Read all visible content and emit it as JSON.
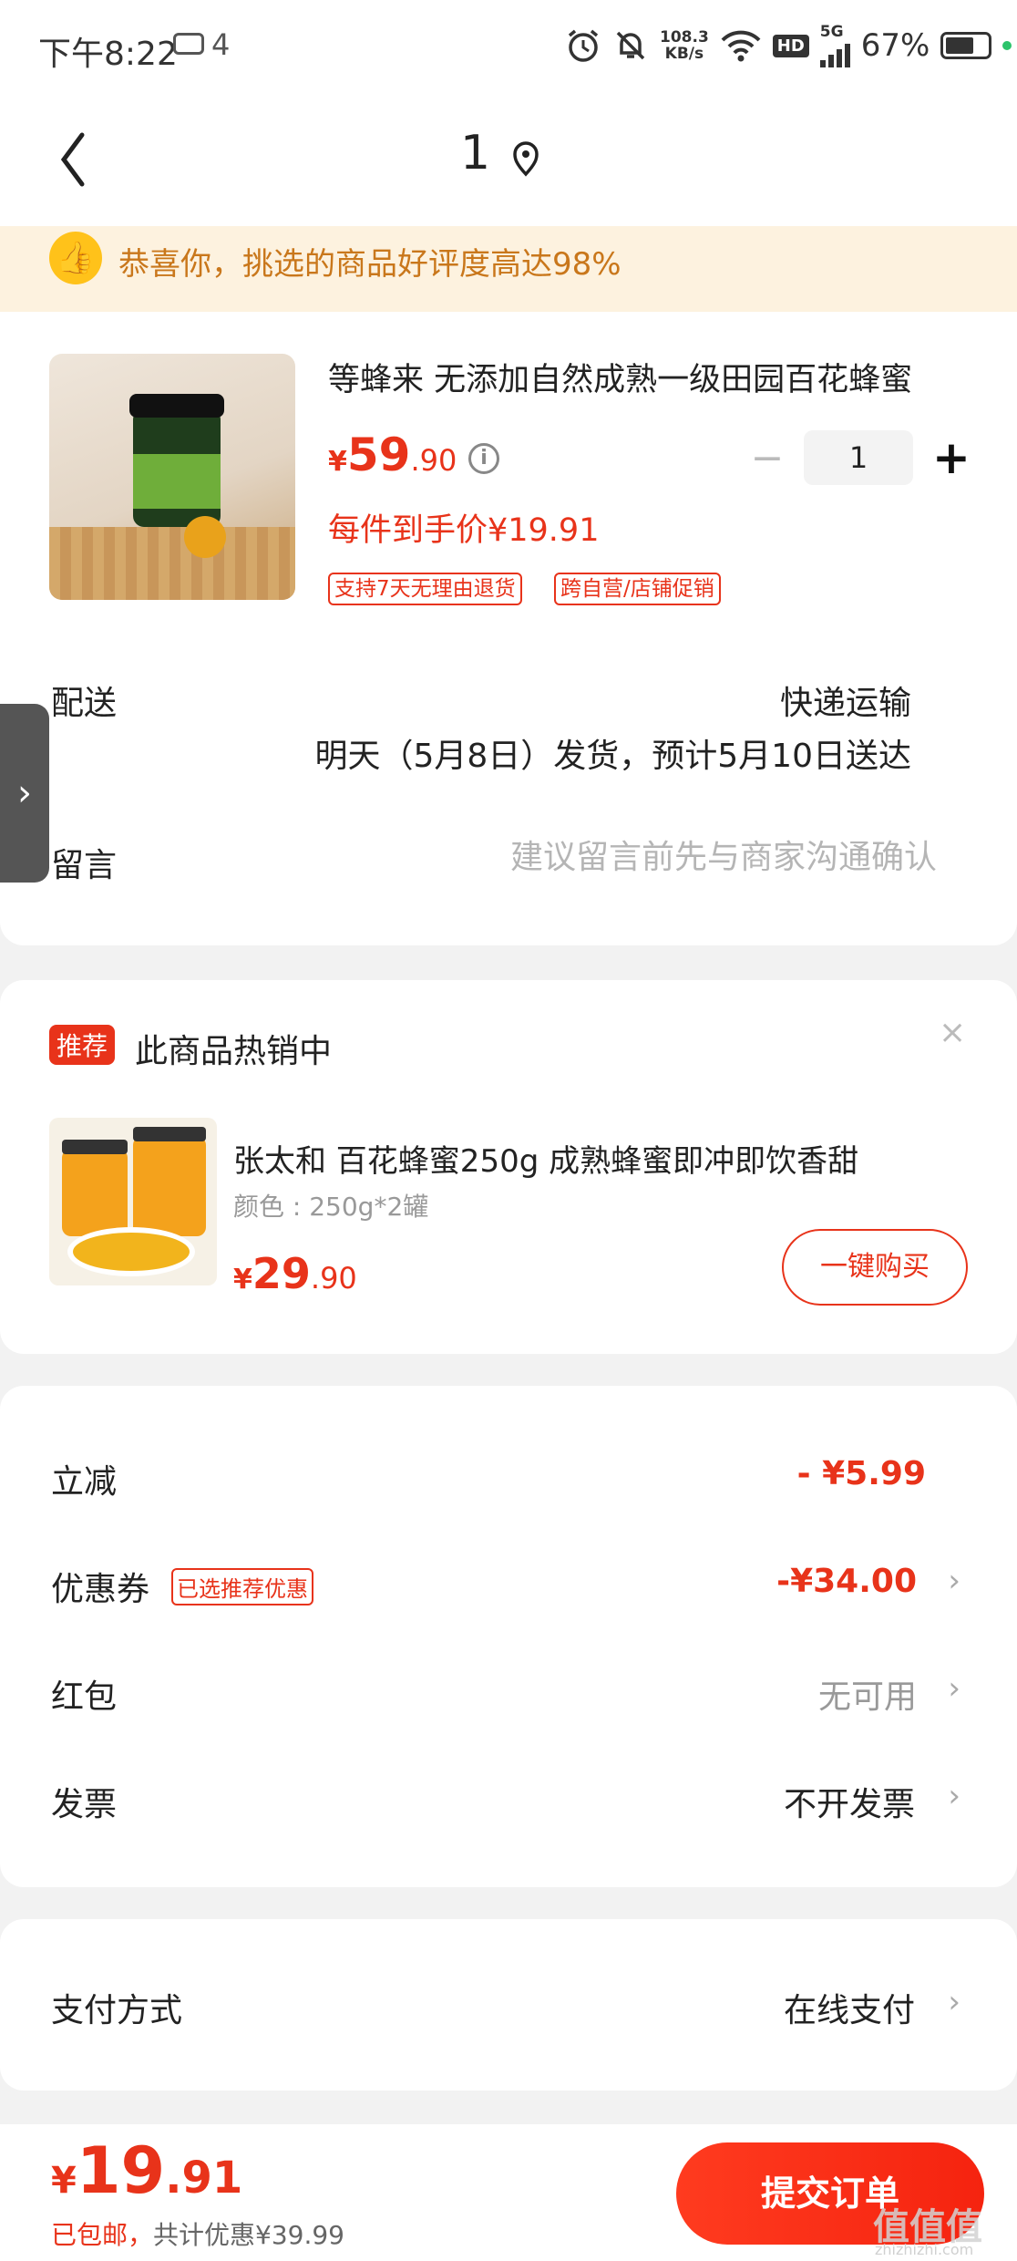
{
  "status_bar": {
    "time": "下午8:22",
    "msg_count": "4",
    "net_speed_value": "108.3",
    "net_speed_unit": "KB/s",
    "hd": "HD",
    "network": "5G",
    "battery": "67%"
  },
  "header": {
    "title": "1",
    "icons": [
      "back-icon",
      "location-pin-icon"
    ]
  },
  "banner": {
    "text": "恭喜你，挑选的商品好评度高达98%"
  },
  "product": {
    "title": "等蜂来 无添加自然成熟一级田园百花蜂蜜",
    "price_symbol": "¥",
    "price_int": "59",
    "price_dec": ".90",
    "quantity": "1",
    "unit_price": "每件到手价¥19.91",
    "tags": [
      "支持7天无理由退货",
      "跨自营/店铺促销"
    ]
  },
  "shipping": {
    "label": "配送",
    "type": "快递运输",
    "date": "明天（5月8日）发货，预计5月10日送达"
  },
  "message": {
    "label": "留言",
    "placeholder": "建议留言前先与商家沟通确认"
  },
  "recommend": {
    "badge": "推荐",
    "title": "此商品热销中",
    "close": "×",
    "name": "张太和 百花蜂蜜250g 成熟蜂蜜即冲即饮香甜",
    "spec": "颜色 : 250g*2罐",
    "price_symbol": "¥",
    "price_int": "29",
    "price_dec": ".90",
    "button": "一键购买"
  },
  "discounts": {
    "direct_label": "立减",
    "direct_value": "- ¥5.99",
    "coupon_label": "优惠券",
    "coupon_badge": "已选推荐优惠",
    "coupon_value": "-¥34.00",
    "redpacket_label": "红包",
    "redpacket_value": "无可用",
    "invoice_label": "发票",
    "invoice_value": "不开发票"
  },
  "payment": {
    "label": "支付方式",
    "value": "在线支付"
  },
  "footer": {
    "total_symbol": "¥",
    "total_int": "19",
    "total_dec": ".91",
    "shipping_note": "已包邮，",
    "saving_note": "共计优惠¥39.99",
    "submit": "提交订单",
    "watermark": "值值值",
    "watermark_sub": "zhizhizhi.com"
  },
  "colors": {
    "accent": "#e8331a",
    "banner_bg": "#fdf2df",
    "banner_text": "#c9771b"
  }
}
